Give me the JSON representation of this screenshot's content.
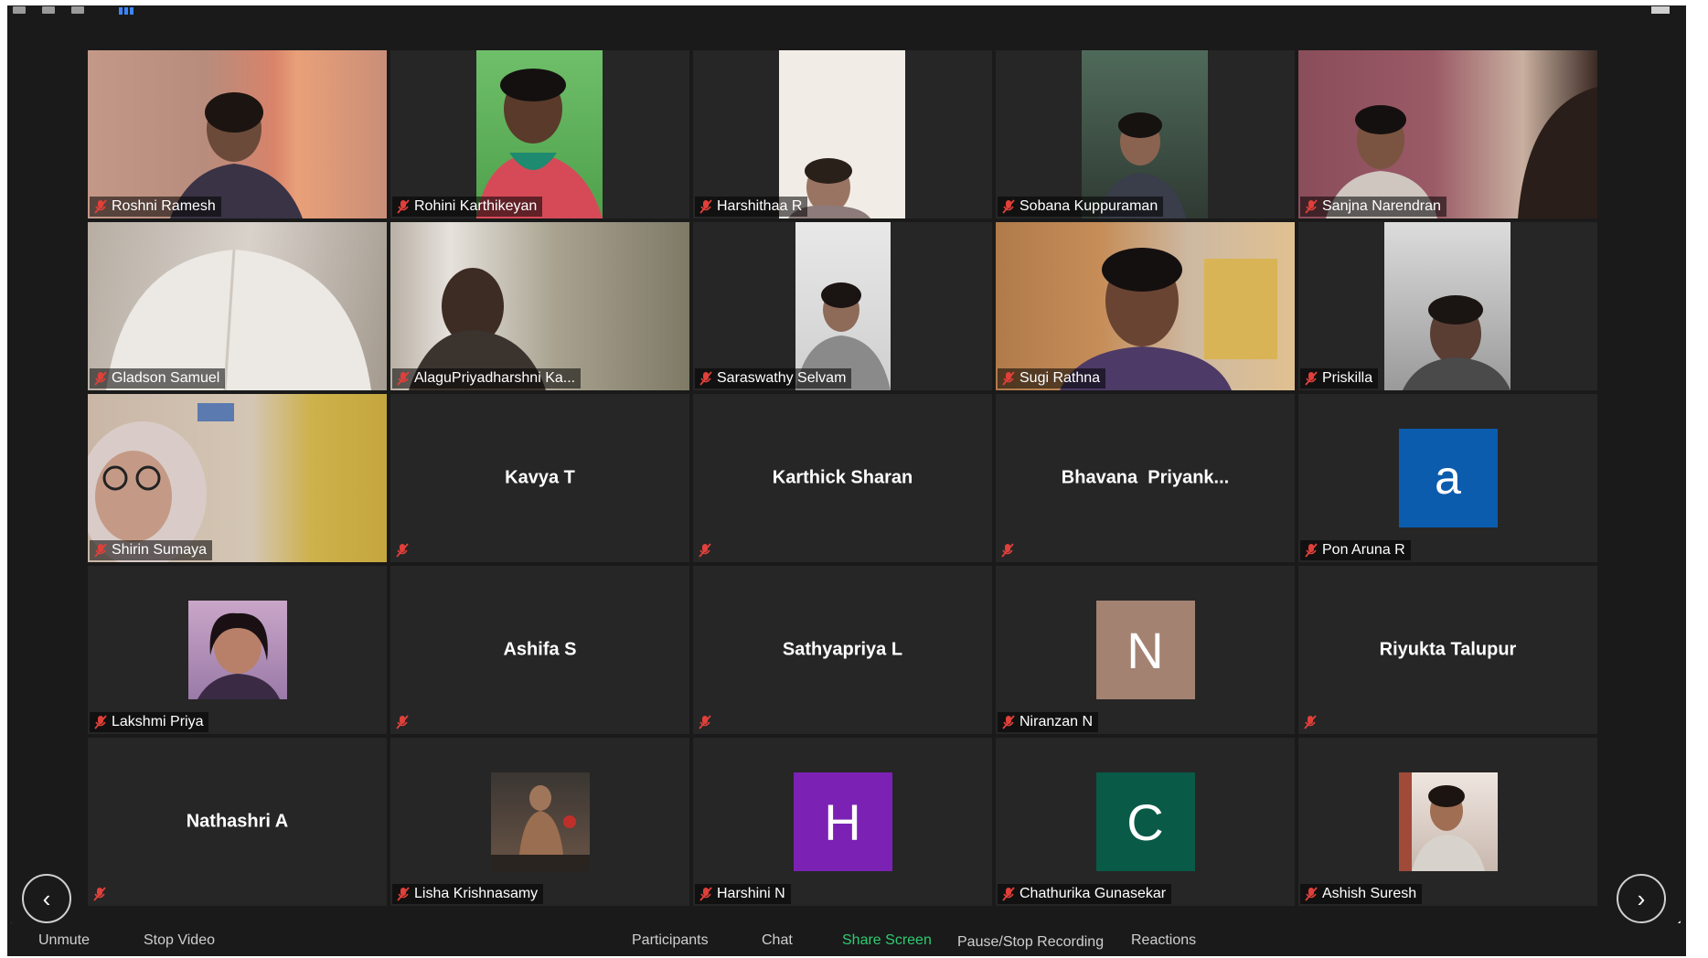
{
  "toolbar": {
    "unmute": "Unmute",
    "stop_video": "Stop Video",
    "participants": "Participants",
    "chat": "Chat",
    "share_screen": "Share Screen",
    "recording": "Pause/Stop Recording",
    "reactions": "Reactions"
  },
  "colors": {
    "window_bg": "#1a1a1a",
    "tile_bg": "#262626",
    "share_green": "#2ecc71",
    "muted_red": "#e0403a",
    "avatar_blue": "#0b5cad",
    "avatar_brown": "#a38272",
    "avatar_purple": "#7b22b5",
    "avatar_green": "#0a5a48"
  },
  "icons": {
    "prev_page": "chevron-left-icon",
    "next_page": "chevron-right-icon",
    "muted": "muted-mic-icon"
  },
  "participants": [
    {
      "name": "Roshni Ramesh"
    },
    {
      "name": "Rohini Karthikeyan"
    },
    {
      "name": "Harshithaa R"
    },
    {
      "name": "Sobana Kuppuraman"
    },
    {
      "name": "Sanjna Narendran"
    },
    {
      "name": "Gladson Samuel"
    },
    {
      "name": "AlaguPriyadharshni Ka..."
    },
    {
      "name": "Saraswathy Selvam"
    },
    {
      "name": "Sugi Rathna"
    },
    {
      "name": "Priskilla"
    },
    {
      "name": "Shirin Sumaya"
    },
    {
      "name": "Kavya T"
    },
    {
      "name": "Karthick Sharan"
    },
    {
      "name": "Bhavana  Priyank..."
    },
    {
      "name": "Pon Aruna R",
      "avatar_letter": "a"
    },
    {
      "name": "Lakshmi Priya"
    },
    {
      "name": "Ashifa S"
    },
    {
      "name": "Sathyapriya L"
    },
    {
      "name": "Niranzan N",
      "avatar_letter": "N"
    },
    {
      "name": "Riyukta Talupur"
    },
    {
      "name": "Nathashri A"
    },
    {
      "name": "Lisha Krishnasamy"
    },
    {
      "name": "Harshini N",
      "avatar_letter": "H"
    },
    {
      "name": "Chathurika Gunasekar",
      "avatar_letter": "C"
    },
    {
      "name": "Ashish Suresh"
    }
  ]
}
